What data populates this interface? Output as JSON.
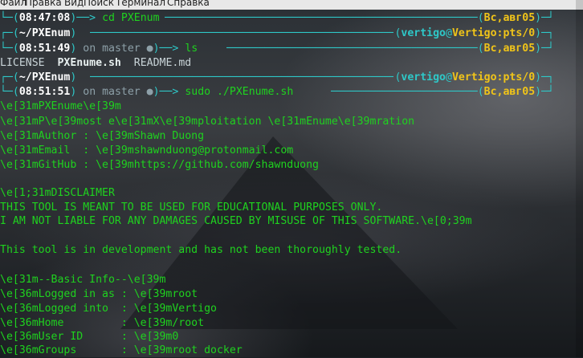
{
  "menubar": {
    "items": [
      "Файл",
      "Правка",
      "Вид",
      "Поиск",
      "Терминал",
      "Справка"
    ]
  },
  "prompts": [
    {
      "time": "08:47:08",
      "git": "",
      "cmd": "cd PXEnum",
      "date": "Вс,авг05"
    },
    {
      "dir": "~/PXEnum",
      "user": "vertigo",
      "host": "Vertigo:pts/0",
      "time": "08:51:49",
      "git": "on master ●",
      "cmd": "ls",
      "date": "Вс,авг05"
    },
    {
      "dir": "~/PXEnum",
      "user": "vertigo",
      "host": "Vertigo:pts/0",
      "time": "08:51:51",
      "git": "on master ●",
      "cmd": "sudo ./PXEnume.sh",
      "date": "Вс,авг05"
    }
  ],
  "ls_output": {
    "license": "LICENSE",
    "script": "PXEnume.sh",
    "readme": "README.md"
  },
  "output": [
    "\\e[31mPXEnume\\e[39m",
    "\\e[31mP\\e[39most e\\e[31mX\\e[39mploitation \\e[31mEnume\\e[39mration",
    "\\e[31mAuthor : \\e[39mShawn Duong",
    "\\e[31mEmail  : \\e[39mshawnduong@protonmail.com",
    "\\e[31mGitHub : \\e[39mhttps://github.com/shawnduong",
    "",
    "\\e[1;31mDISCLAIMER",
    "THIS TOOL IS MEANT TO BE USED FOR EDUCATIONAL PURPOSES ONLY.",
    "I AM NOT LIABLE FOR ANY DAMAGES CAUSED BY MISUSE OF THIS SOFTWARE.\\e[0;39m",
    "",
    "This tool is in development and has not been thoroughly tested.",
    "",
    "\\e[31m--Basic Info--\\e[39m",
    "\\e[36mLogged in as : \\e[39mroot",
    "\\e[36mLogged into  : \\e[39mVertigo",
    "\\e[36mHome         : \\e[39m/root",
    "\\e[36mUser ID      : \\e[39m0",
    "\\e[36mGroups       : \\e[39mroot docker"
  ]
}
